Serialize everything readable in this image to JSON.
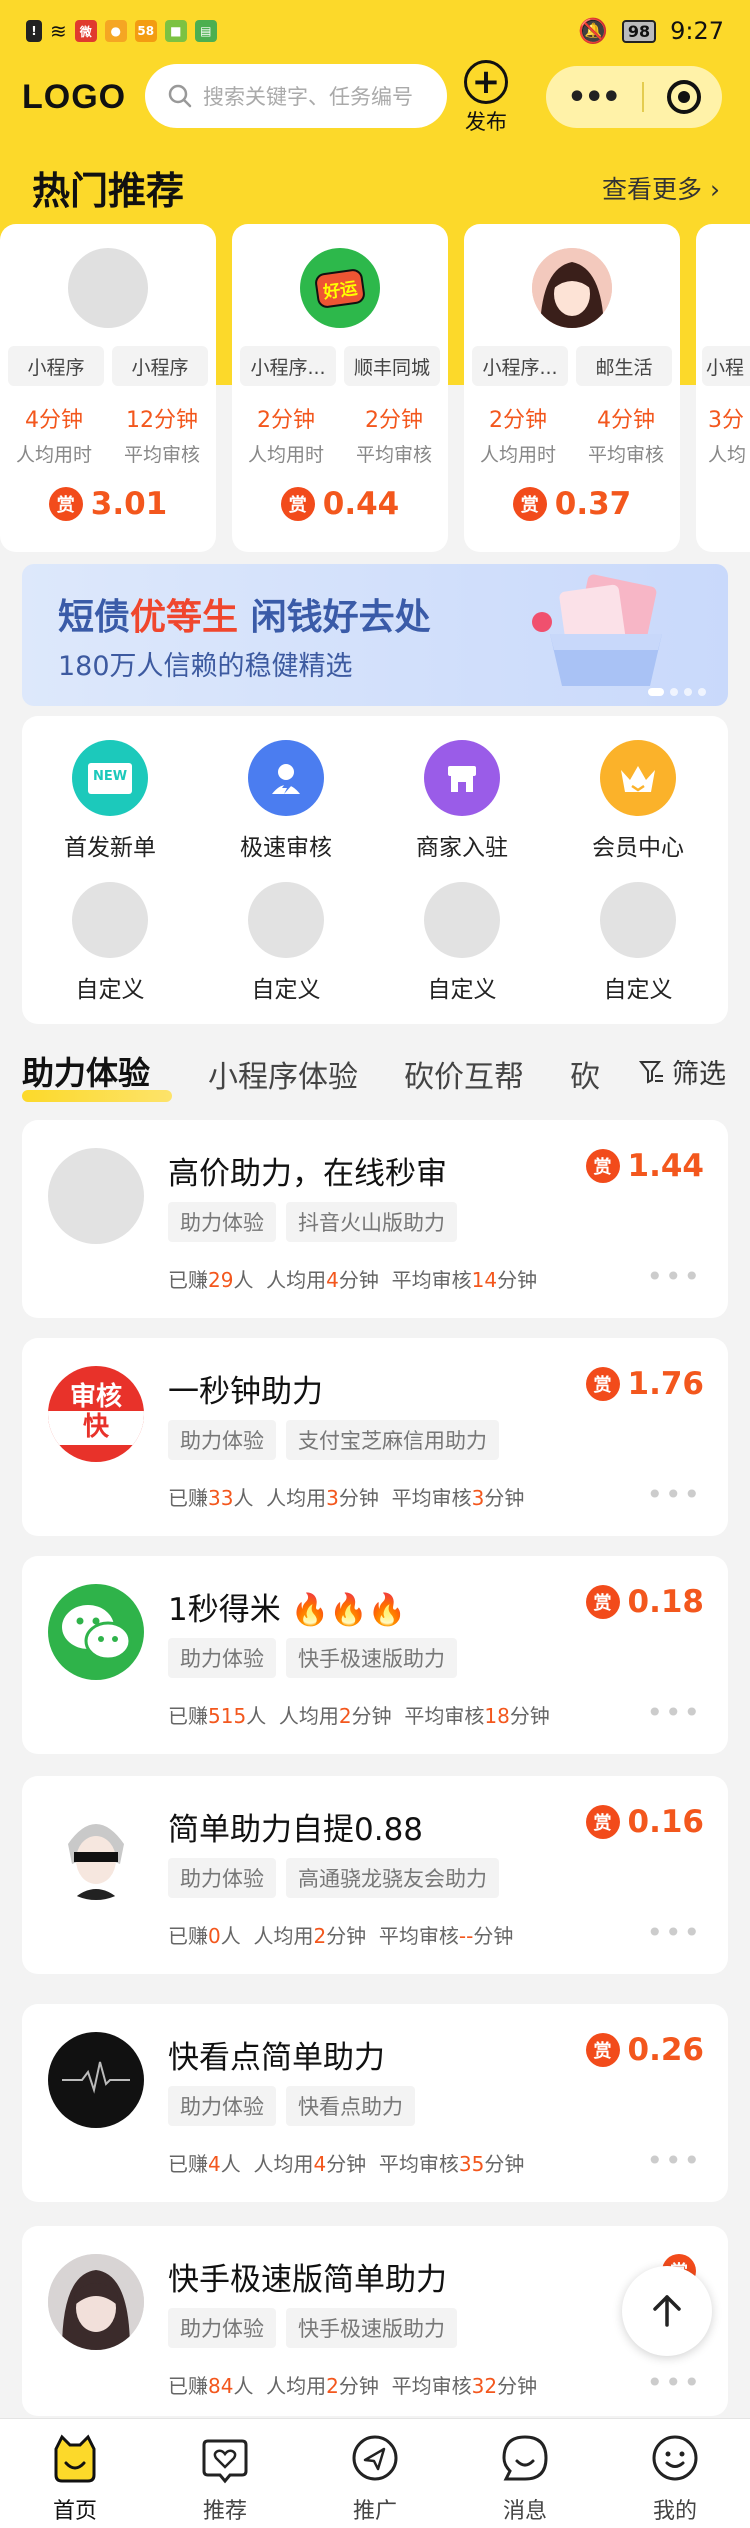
{
  "status_bar": {
    "time": "9:27",
    "battery": "98"
  },
  "header": {
    "logo": "LOGO",
    "search_placeholder": "搜索关键字、任务编号",
    "publish_label": "发布"
  },
  "hot": {
    "title": "热门推荐",
    "more_label": "查看更多",
    "cards": [
      {
        "tags": [
          "小程序",
          "小程序"
        ],
        "stat1_value": "4分钟",
        "stat1_label": "人均用时",
        "stat2_value": "12分钟",
        "stat2_label": "平均审核",
        "reward_icon": "赏",
        "reward": "3.01"
      },
      {
        "tags": [
          "小程序...",
          "顺丰同城"
        ],
        "stat1_value": "2分钟",
        "stat1_label": "人均用时",
        "stat2_value": "2分钟",
        "stat2_label": "平均审核",
        "reward_icon": "赏",
        "reward": "0.44",
        "avatar_text": "好运"
      },
      {
        "tags": [
          "小程序...",
          "邮生活"
        ],
        "stat1_value": "2分钟",
        "stat1_label": "人均用时",
        "stat2_value": "4分钟",
        "stat2_label": "平均审核",
        "reward_icon": "赏",
        "reward": "0.37"
      },
      {
        "tags": [
          "小程"
        ],
        "stat1_value": "3分",
        "stat1_label": "人均",
        "stat2_value": "",
        "stat2_label": "",
        "reward_icon": "",
        "reward": ""
      }
    ]
  },
  "banner": {
    "title_a": "短债",
    "title_highlight": "优等生",
    "title_b": " 闲钱好去处",
    "subtitle": "180万人信赖的稳健精选"
  },
  "grid": {
    "items": [
      {
        "label": "首发新单",
        "icon": "new-icon",
        "badge": "NEW"
      },
      {
        "label": "极速审核",
        "icon": "speed-review-icon"
      },
      {
        "label": "商家入驻",
        "icon": "store-icon"
      },
      {
        "label": "会员中心",
        "icon": "crown-icon"
      },
      {
        "label": "自定义",
        "icon": "placeholder-icon"
      },
      {
        "label": "自定义",
        "icon": "placeholder-icon"
      },
      {
        "label": "自定义",
        "icon": "placeholder-icon"
      },
      {
        "label": "自定义",
        "icon": "placeholder-icon"
      }
    ]
  },
  "tabs": {
    "items": [
      "助力体验",
      "小程序体验",
      "砍价互帮",
      "砍"
    ],
    "filter_label": "筛选"
  },
  "tasks": [
    {
      "title": "高价助力，在线秒审",
      "tags": [
        "助力体验",
        "抖音火山版助力"
      ],
      "earned_pre": "已赚",
      "earned": "29",
      "earned_post": "人",
      "avg_pre": "人均用",
      "avg": "4",
      "avg_post": "分钟",
      "review_pre": "平均审核",
      "review": "14",
      "review_post": "分钟",
      "reward_icon": "赏",
      "reward": "1.44"
    },
    {
      "title": "一秒钟助力",
      "tags": [
        "助力体验",
        "支付宝芝麻信用助力"
      ],
      "earned_pre": "已赚",
      "earned": "33",
      "earned_post": "人",
      "avg_pre": "人均用",
      "avg": "3",
      "avg_post": "分钟",
      "review_pre": "平均审核",
      "review": "3",
      "review_post": "分钟",
      "reward_icon": "赏",
      "reward": "1.76",
      "avatar_text_top": "审核",
      "avatar_text_bottom": "快"
    },
    {
      "title": "1秒得米",
      "title_suffix": "🔥🔥🔥",
      "tags": [
        "助力体验",
        "快手极速版助力"
      ],
      "earned_pre": "已赚",
      "earned": "515",
      "earned_post": "人",
      "avg_pre": "人均用",
      "avg": "2",
      "avg_post": "分钟",
      "review_pre": "平均审核",
      "review": "18",
      "review_post": "分钟",
      "reward_icon": "赏",
      "reward": "0.18"
    },
    {
      "title": "简单助力自提0.88",
      "tags": [
        "助力体验",
        "高通骁龙骁友会助力"
      ],
      "earned_pre": "已赚",
      "earned": "0",
      "earned_post": "人",
      "avg_pre": "人均用",
      "avg": "2",
      "avg_post": "分钟",
      "review_pre": "平均审核",
      "review": "--",
      "review_post": "分钟",
      "reward_icon": "赏",
      "reward": "0.16"
    },
    {
      "title": "快看点简单助力",
      "tags": [
        "助力体验",
        "快看点助力"
      ],
      "earned_pre": "已赚",
      "earned": "4",
      "earned_post": "人",
      "avg_pre": "人均用",
      "avg": "4",
      "avg_post": "分钟",
      "review_pre": "平均审核",
      "review": "35",
      "review_post": "分钟",
      "reward_icon": "赏",
      "reward": "0.26"
    },
    {
      "title": "快手极速版简单助力",
      "tags": [
        "助力体验",
        "快手极速版助力"
      ],
      "earned_pre": "已赚",
      "earned": "84",
      "earned_post": "人",
      "avg_pre": "人均用",
      "avg": "2",
      "avg_post": "分钟",
      "review_pre": "平均审核",
      "review": "32",
      "review_post": "分钟",
      "reward_icon": "赏",
      "reward": ""
    }
  ],
  "tabbar": {
    "items": [
      "首页",
      "推荐",
      "推广",
      "消息",
      "我的"
    ]
  },
  "colors": {
    "brand_yellow": "#fcd92a",
    "accent_orange": "#f3571d"
  }
}
